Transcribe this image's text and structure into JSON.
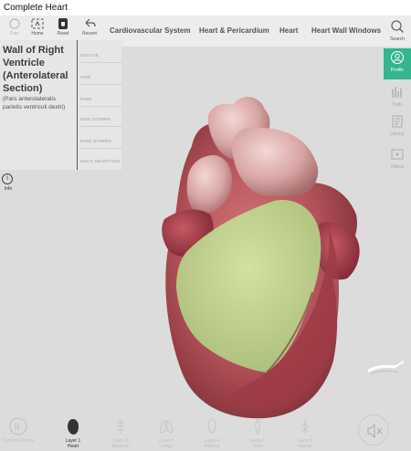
{
  "window": {
    "title": "Complete Heart"
  },
  "toolbar": {
    "buttons": [
      {
        "name": "free-button",
        "label": "Free"
      },
      {
        "name": "home-button",
        "label": "Home"
      },
      {
        "name": "reset-button",
        "label": "Reset"
      },
      {
        "name": "recent-button",
        "label": "Recent"
      }
    ],
    "breadcrumbs": [
      "Cardiovascular System",
      "Heart & Pericardium",
      "Heart",
      "Heart Wall Windows"
    ]
  },
  "selection": {
    "title": "Wall of Right Ventricle (Anterolateral Section)",
    "latin": "(Pars anterolateralis parietis ventriculi dextri)",
    "tabs": [
      "ISOLATE",
      "HIDE",
      "FADE",
      "HIDE OTHERS",
      "FADE OTHERS",
      "MULTI SELECTION"
    ]
  },
  "info": {
    "label": "Info"
  },
  "right_panel": {
    "search": "Search",
    "profile": "Profile",
    "tools": "Tools",
    "library": "Library",
    "videos": "Videos"
  },
  "layers": {
    "add": "Custom Models",
    "items": [
      "Layer 1\nHeart",
      "Layer 2\nSkeleton",
      "Layer 3\nLungs",
      "Layer 4\nArteries",
      "Layer 5\nVeins",
      "Layer 6\nNerves"
    ]
  },
  "colors": {
    "accent": "#34b48f",
    "highlight": "#b8d68a",
    "muscle": "#b4525a"
  }
}
